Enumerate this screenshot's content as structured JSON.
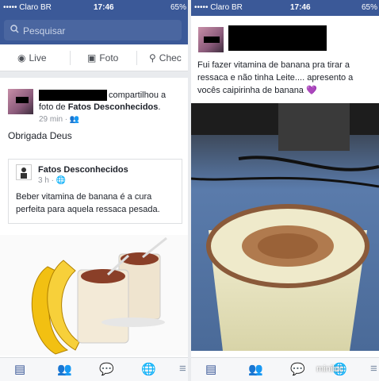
{
  "status": {
    "carrier": "••••• Claro BR",
    "time": "17:46",
    "battery": "65%"
  },
  "search": {
    "placeholder": "Pesquisar"
  },
  "actions": {
    "live": "Live",
    "photo": "Foto",
    "checkin": "Chec"
  },
  "left_post": {
    "shared_line1": "compartilhou a",
    "shared_line2_prefix": "foto de ",
    "shared_line2_page": "Fatos Desconhecidos",
    "shared_line2_suffix": ".",
    "time": "29 min ·",
    "message": "Obrigada Deus",
    "shared_page": "Fatos Desconhecidos",
    "shared_time": "3 h ·",
    "shared_text_line1": "Beber vitamina de banana é a cura",
    "shared_text_line2": "perfeita para aquela ressaca pesada."
  },
  "right_post": {
    "line1": "Fui fazer vitamina de banana pra tirar a",
    "line2": "ressaca e não tinha Leite.... apresento a",
    "line3": "vocês caipirinha de banana 💜"
  },
  "watermark": "miniluc",
  "icons": {
    "search": "search-icon",
    "live": "live-icon",
    "camera": "camera-icon",
    "checkin": "location-pin-icon",
    "nav": [
      "news-feed-icon",
      "friends-icon",
      "messenger-icon",
      "globe-icon",
      "menu-icon"
    ]
  },
  "colors": {
    "facebook_blue": "#3b5998",
    "link_blue": "#365899"
  }
}
